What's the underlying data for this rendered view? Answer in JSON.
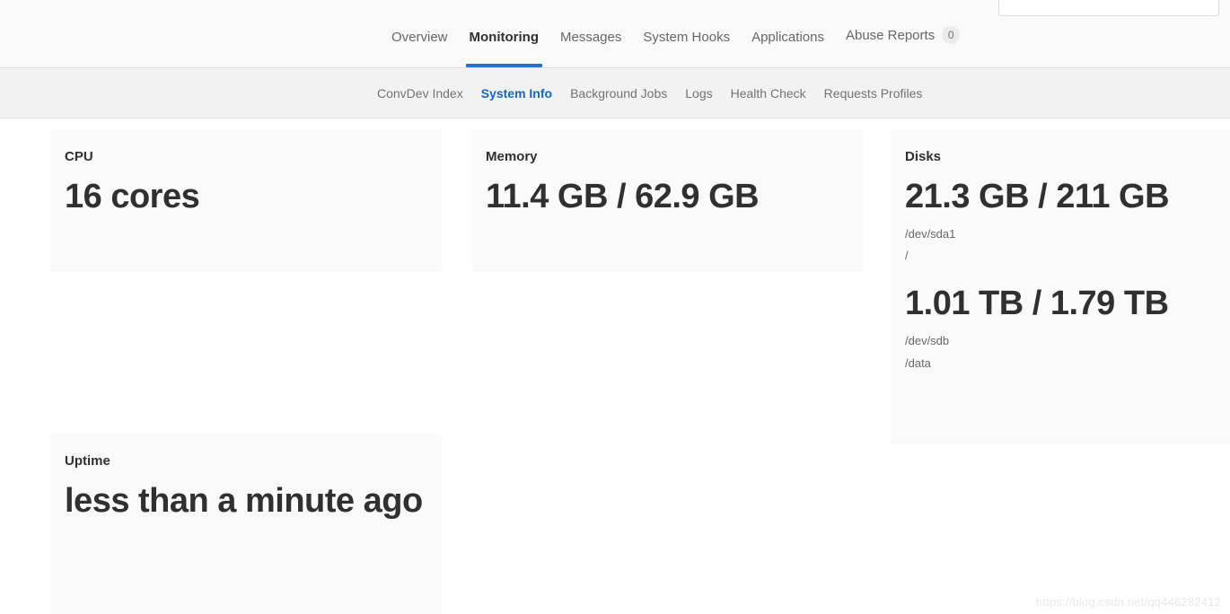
{
  "search": {
    "value": "",
    "placeholder": ""
  },
  "primary_nav": {
    "tabs": [
      {
        "label": "Overview",
        "active": false,
        "badge": null
      },
      {
        "label": "Monitoring",
        "active": true,
        "badge": null
      },
      {
        "label": "Messages",
        "active": false,
        "badge": null
      },
      {
        "label": "System Hooks",
        "active": false,
        "badge": null
      },
      {
        "label": "Applications",
        "active": false,
        "badge": null
      },
      {
        "label": "Abuse Reports",
        "active": false,
        "badge": "0"
      }
    ],
    "active_underline_color": "#1f75cb"
  },
  "secondary_nav": {
    "items": [
      {
        "label": "ConvDev Index",
        "active": false
      },
      {
        "label": "System Info",
        "active": true
      },
      {
        "label": "Background Jobs",
        "active": false
      },
      {
        "label": "Logs",
        "active": false
      },
      {
        "label": "Health Check",
        "active": false
      },
      {
        "label": "Requests Profiles",
        "active": false
      }
    ],
    "active_color": "#1068bf"
  },
  "cards": {
    "cpu": {
      "title": "CPU",
      "value": "16 cores"
    },
    "memory": {
      "title": "Memory",
      "value": "11.4 GB / 62.9 GB"
    },
    "disks": {
      "title": "Disks",
      "entries": [
        {
          "value": "21.3 GB / 211 GB",
          "device": "/dev/sda1",
          "mount": "/"
        },
        {
          "value": "1.01 TB / 1.79 TB",
          "device": "/dev/sdb",
          "mount": "/data"
        }
      ]
    },
    "uptime": {
      "title": "Uptime",
      "value": "less than a minute ago"
    }
  },
  "watermark": {
    "text": "https://blog.csdn.net/qq446282412"
  }
}
